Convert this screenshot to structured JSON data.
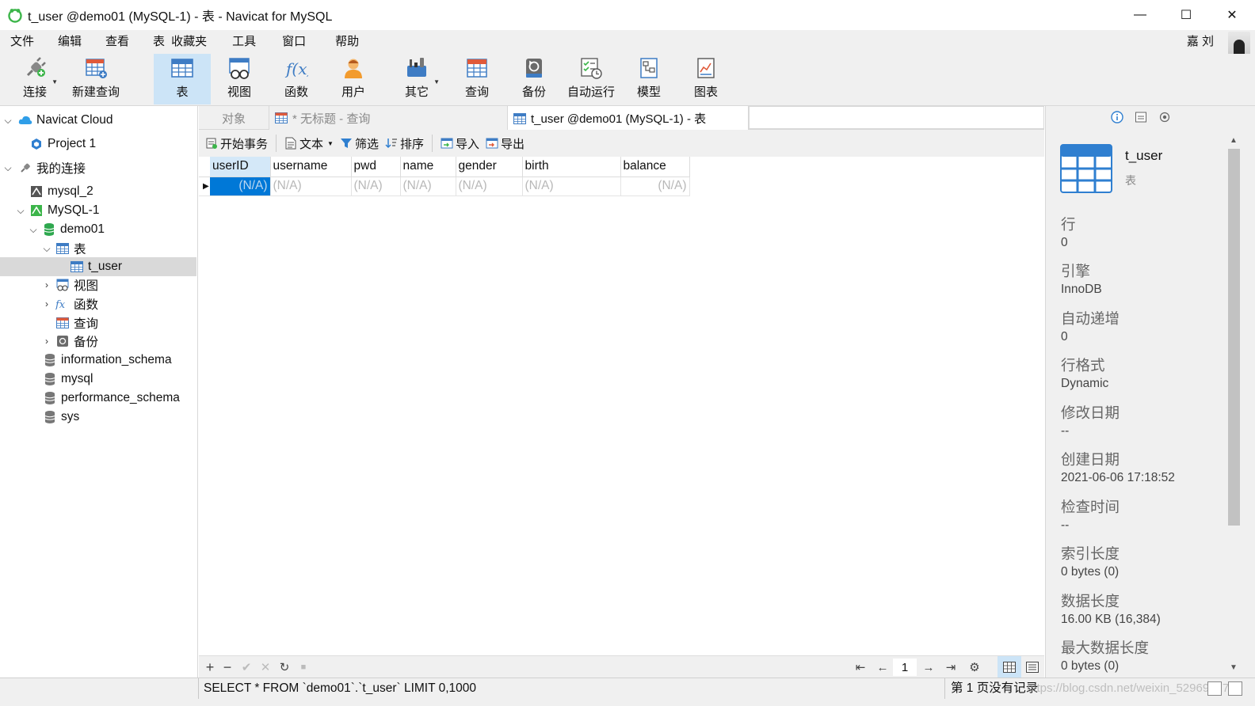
{
  "window": {
    "title": "t_user @demo01 (MySQL-1) - 表 - Navicat for MySQL",
    "minimize": "—",
    "maximize": "☐",
    "close": "✕"
  },
  "menu": {
    "items": [
      "文件",
      "编辑",
      "查看",
      "表",
      "收藏夹",
      "工具",
      "窗口",
      "帮助"
    ],
    "user": "嘉 刘"
  },
  "toolbar": {
    "connect": "连接",
    "new_query": "新建查询",
    "table": "表",
    "view": "视图",
    "function": "函数",
    "user": "用户",
    "other": "其它",
    "query": "查询",
    "backup": "备份",
    "auto_run": "自动运行",
    "model": "模型",
    "chart": "图表"
  },
  "tree": {
    "cloud": "Navicat Cloud",
    "project": "Project 1",
    "my_connections": "我的连接",
    "mysql2": "mysql_2",
    "mysql1": "MySQL-1",
    "demo01": "demo01",
    "tables": "表",
    "t_user": "t_user",
    "views": "视图",
    "functions": "函数",
    "queries": "查询",
    "backups": "备份",
    "info_schema": "information_schema",
    "mysql": "mysql",
    "perf_schema": "performance_schema",
    "sys": "sys"
  },
  "tabs": {
    "objects": "对象",
    "untitled_query": "* 无标题 - 查询",
    "table_tab": "t_user @demo01 (MySQL-1) - 表"
  },
  "subtoolbar": {
    "begin_transaction": "开始事务",
    "text": "文本",
    "filter": "筛选",
    "sort": "排序",
    "import": "导入",
    "export": "导出"
  },
  "grid": {
    "columns": [
      "userID",
      "username",
      "pwd",
      "name",
      "gender",
      "birth",
      "balance"
    ],
    "row": [
      "(N/A)",
      "(N/A)",
      "(N/A)",
      "(N/A)",
      "(N/A)",
      "(N/A)",
      "(N/A)"
    ]
  },
  "gridnav": {
    "page": "1"
  },
  "status": {
    "sql": "SELECT * FROM `demo01`.`t_user` LIMIT 0,1000",
    "page_info": "第 1 页没有记录",
    "watermark": "https://blog.csdn.net/weixin_52969827"
  },
  "info": {
    "name": "t_user",
    "type": "表",
    "props": [
      {
        "label": "行",
        "value": "0"
      },
      {
        "label": "引擎",
        "value": "InnoDB"
      },
      {
        "label": "自动递增",
        "value": "0"
      },
      {
        "label": "行格式",
        "value": "Dynamic"
      },
      {
        "label": "修改日期",
        "value": "--"
      },
      {
        "label": "创建日期",
        "value": "2021-06-06 17:18:52"
      },
      {
        "label": "检查时间",
        "value": "--"
      },
      {
        "label": "索引长度",
        "value": "0 bytes (0)"
      },
      {
        "label": "数据长度",
        "value": "16.00 KB (16,384)"
      },
      {
        "label": "最大数据长度",
        "value": "0 bytes (0)"
      }
    ]
  },
  "colors": {
    "accent": "#0078d7",
    "active_tool": "#cce4f7",
    "navicat_green": "#3cb54a",
    "db_green": "#2fa84f",
    "cloud_blue": "#2f9ee8"
  }
}
